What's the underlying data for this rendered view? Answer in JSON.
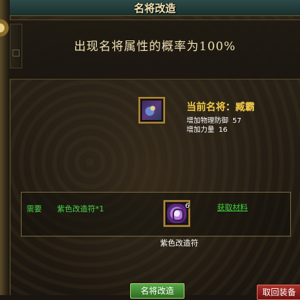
{
  "window": {
    "title": "名将改造"
  },
  "probability": {
    "text": "出现名将属性的概率为100%"
  },
  "current_general": {
    "name": "当前名将：臧霸",
    "stats": [
      {
        "label": "增加物理防御",
        "value": "57"
      },
      {
        "label": "增加力量",
        "value": "16"
      }
    ]
  },
  "requirement": {
    "label": "需要",
    "item": "紫色改造符*1",
    "item_count": "6",
    "item_name": "紫色改造符",
    "get_link": "获取材料"
  },
  "buttons": {
    "reform": "名将改造",
    "retrieve": "取回装备"
  },
  "colors": {
    "title_text": "#f2e2b0",
    "general_name": "#f0c84a",
    "requirement_green": "#4ad24a",
    "button_green": "#3f8a30",
    "button_red": "#8a1e18"
  },
  "icons": {
    "general_slot": "general-portrait-icon",
    "material_slot": "purple-reform-charm-icon"
  }
}
